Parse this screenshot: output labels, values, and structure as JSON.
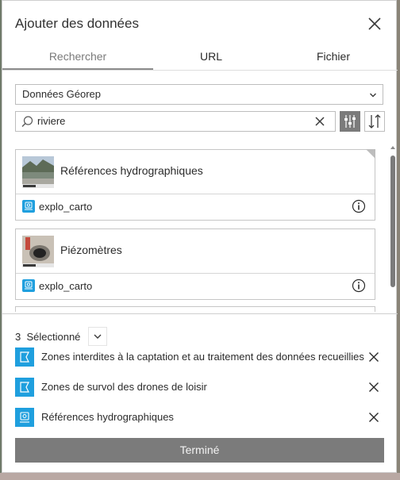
{
  "dialog": {
    "title": "Ajouter des données"
  },
  "tabs": [
    {
      "label": "Rechercher",
      "active": true
    },
    {
      "label": "URL",
      "active": false
    },
    {
      "label": "Fichier",
      "active": false
    }
  ],
  "source_select": {
    "value": "Données Géorep"
  },
  "search": {
    "value": "riviere"
  },
  "results": [
    {
      "title": "Références hydrographiques",
      "owner": "explo_carto",
      "thumbnail": "river-landscape-thumbnail"
    },
    {
      "title": "Piézomètres",
      "owner": "explo_carto",
      "thumbnail": "well-thumbnail"
    }
  ],
  "selection": {
    "count": "3",
    "label": "Sélectionné",
    "items": [
      {
        "label": "Zones interdites à la captation et au traitement des données recueillies",
        "icon": "polygon-layer-icon"
      },
      {
        "label": "Zones de survol des drones de loisir",
        "icon": "polygon-layer-icon"
      },
      {
        "label": "Références hydrographiques",
        "icon": "map-service-icon"
      }
    ]
  },
  "done_button": {
    "label": "Terminé"
  },
  "colors": {
    "accent_blue": "#1f9fde",
    "button_gray": "#7b7b7b"
  }
}
